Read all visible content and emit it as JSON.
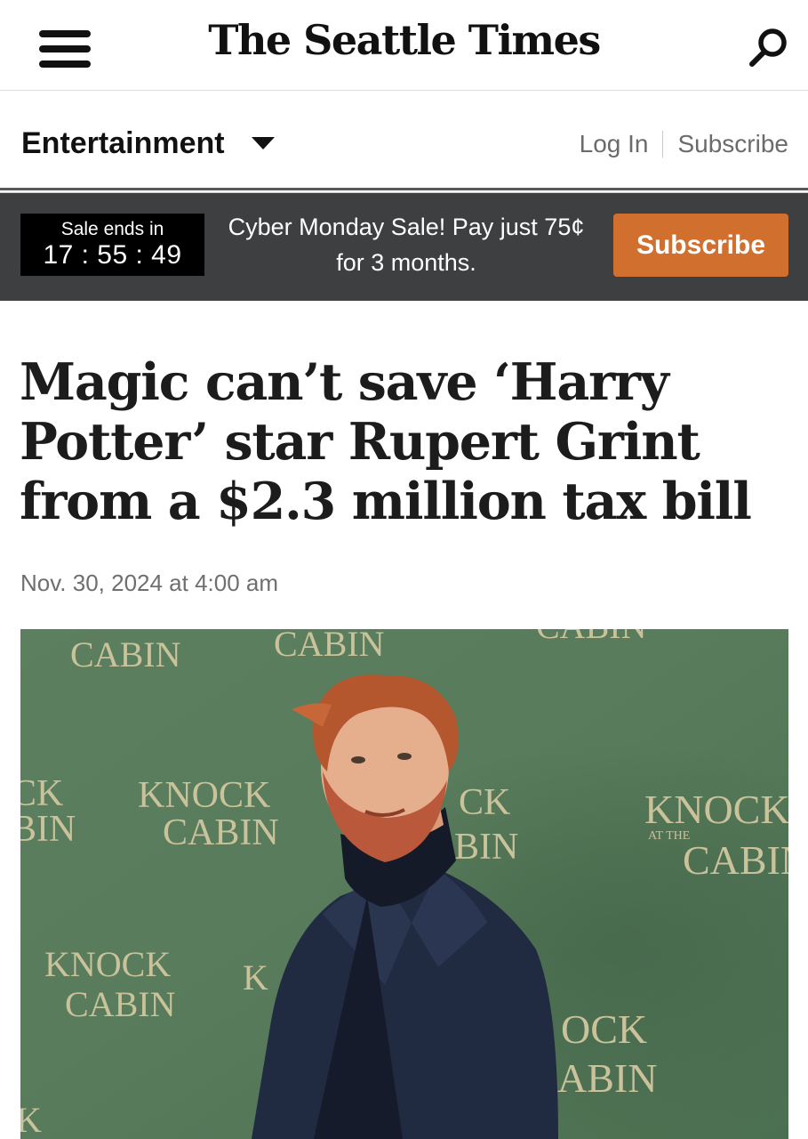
{
  "masthead": {
    "logo_text": "The Seattle Times",
    "menu_icon": "hamburger-menu-icon",
    "search_icon": "search-icon"
  },
  "section": {
    "title": "Entertainment",
    "dropdown_icon": "caret-down-icon",
    "login_label": "Log In",
    "subscribe_label": "Subscribe"
  },
  "sale_banner": {
    "countdown_label": "Sale ends in",
    "countdown_time": "17 : 55 : 49",
    "message_line1": "Cyber Monday Sale! Pay just 75¢",
    "message_line2": "for 3 months.",
    "button_label": "Subscribe",
    "button_color": "#d1702e",
    "banner_color": "#3e3f41"
  },
  "article": {
    "headline": "Magic can’t save ‘Harry Potter’ star Rupert Grint from a $2.3 million tax bill",
    "dateline": "Nov. 30, 2024 at 4:00 am",
    "photo_backdrop_texts": [
      "KNOCK",
      "AT THE",
      "CABIN"
    ]
  }
}
